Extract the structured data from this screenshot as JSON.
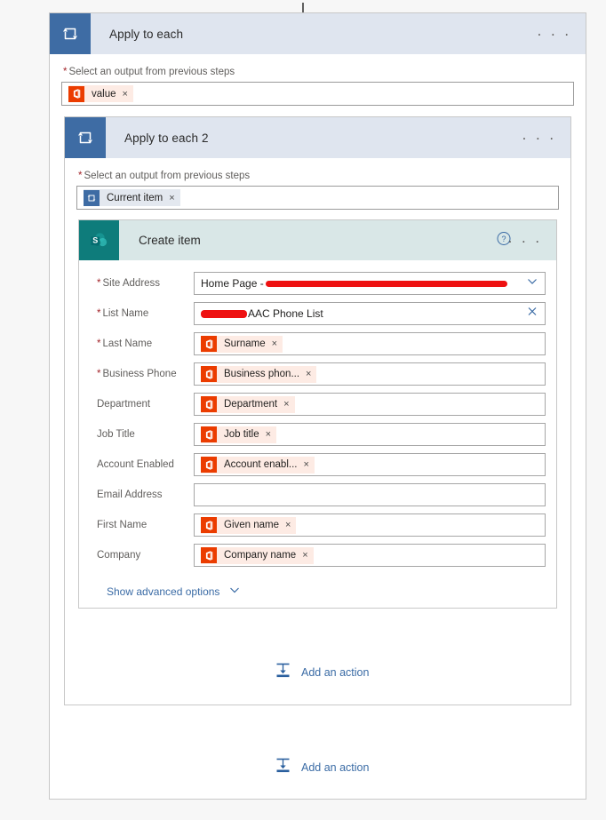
{
  "page": {
    "incoming_arrow_icon": "arrow-down-icon"
  },
  "outer_loop": {
    "icon": "loop-icon",
    "title": "Apply to each",
    "menu_icon": "ellipsis-icon",
    "menu_label": "· · ·",
    "input_label": "Select an output from previous steps",
    "required_marker": "*",
    "token": {
      "icon": "office365-icon",
      "text": "value",
      "remove_icon": "close-icon",
      "remove_label": "×"
    }
  },
  "inner_loop": {
    "icon": "loop-icon",
    "title": "Apply to each 2",
    "menu_icon": "ellipsis-icon",
    "menu_label": "· · ·",
    "input_label": "Select an output from previous steps",
    "required_marker": "*",
    "token": {
      "icon": "loop-icon",
      "text": "Current item",
      "remove_icon": "close-icon",
      "remove_label": "×"
    }
  },
  "sharepoint_card": {
    "icon": "sharepoint-icon",
    "title": "Create item",
    "help_icon": "help-circle-icon",
    "menu_icon": "ellipsis-icon",
    "menu_label": "· · ·",
    "required_marker": "*",
    "fields": [
      {
        "label": "Site Address",
        "required": true,
        "control": "dropdown",
        "value_prefix": "Home Page - ",
        "redacted": true,
        "affordance_icon": "chevron-down-icon"
      },
      {
        "label": "List Name",
        "required": true,
        "control": "combobox",
        "value_suffix": "AAC Phone List",
        "redacted": true,
        "affordance_icon": "close-icon"
      },
      {
        "label": "Last Name",
        "required": true,
        "control": "token",
        "token": {
          "icon": "office365-icon",
          "text": "Surname",
          "remove_label": "×"
        }
      },
      {
        "label": "Business Phone",
        "required": true,
        "control": "token",
        "token": {
          "icon": "office365-icon",
          "text": "Business phon...",
          "remove_label": "×"
        }
      },
      {
        "label": "Department",
        "required": false,
        "control": "token",
        "token": {
          "icon": "office365-icon",
          "text": "Department",
          "remove_label": "×"
        }
      },
      {
        "label": "Job Title",
        "required": false,
        "control": "token",
        "token": {
          "icon": "office365-icon",
          "text": "Job title",
          "remove_label": "×"
        }
      },
      {
        "label": "Account Enabled",
        "required": false,
        "control": "token",
        "token": {
          "icon": "office365-icon",
          "text": "Account enabl...",
          "remove_label": "×"
        }
      },
      {
        "label": "Email Address",
        "required": false,
        "control": "empty",
        "value": "",
        "placeholder": ""
      },
      {
        "label": "First Name",
        "required": false,
        "control": "token",
        "token": {
          "icon": "office365-icon",
          "text": "Given name",
          "remove_label": "×"
        }
      },
      {
        "label": "Company",
        "required": false,
        "control": "token",
        "token": {
          "icon": "office365-icon",
          "text": "Company name",
          "remove_label": "×"
        }
      }
    ],
    "show_advanced": {
      "label": "Show advanced options",
      "chevron_icon": "chevron-down-icon"
    }
  },
  "add_action_inner": {
    "icon": "add-action-icon",
    "label": "Add an action"
  },
  "add_action_outer": {
    "icon": "add-action-icon",
    "label": "Add an action"
  },
  "colors": {
    "loop_header_bg": "#dfe5ef",
    "loop_icon_bg": "#3e6ca4",
    "sharepoint_header_bg": "#d9e7e7",
    "sharepoint_icon_bg": "#0e7c7b",
    "office365_orange": "#eb3c00",
    "token_bg": "#fdebe4",
    "link_blue": "#3a6ba5",
    "required_red": "#a4262c",
    "redaction_red": "#ee1111",
    "page_bg": "#f7f7f7"
  }
}
